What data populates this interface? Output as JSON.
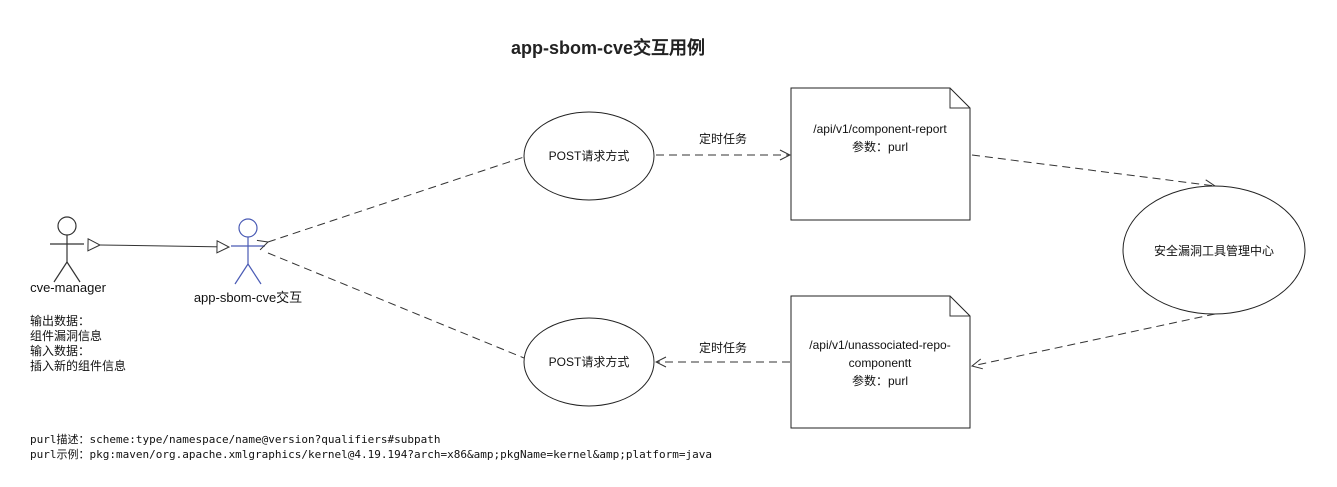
{
  "diagram": {
    "title": "app-sbom-cve交互用例",
    "colors": {
      "line": "#333333",
      "actor_primary": "#333333",
      "actor_secondary": "#4a5bb5",
      "background": "#ffffff"
    },
    "actors": {
      "cve_manager": {
        "label": "cve-manager",
        "notes": [
          "输出数据：",
          "组件漏洞信息",
          "输入数据：",
          "插入新的组件信息"
        ]
      },
      "app_sbom_cve": {
        "label": "app-sbom-cve交互"
      }
    },
    "use_cases": {
      "post_top": {
        "label": "POST请求方式"
      },
      "post_bottom": {
        "label": "POST请求方式"
      },
      "vuln_center": {
        "label": "安全漏洞工具管理中心"
      }
    },
    "notes": {
      "component_report": {
        "lines": [
          "/api/v1/component-report",
          "参数：purl"
        ]
      },
      "unassociated_repo": {
        "lines": [
          "/api/v1/unassociated-repo-",
          "componentt",
          "参数：purl"
        ]
      }
    },
    "edge_labels": {
      "top": "定时任务",
      "bottom": "定时任务"
    },
    "footer": {
      "purl_desc": "purl描述：scheme:type/namespace/name@version?qualifiers#subpath",
      "purl_example": "purl示例：pkg:maven/org.apache.xmlgraphics/kernel@4.19.194?arch=x86&amp;pkgName=kernel&amp;platform=java"
    }
  }
}
